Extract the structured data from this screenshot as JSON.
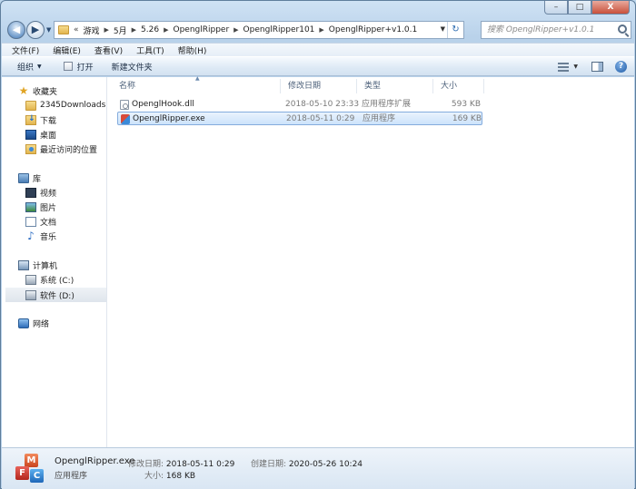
{
  "window": {
    "caption_minimize": "–",
    "caption_maximize": "□",
    "caption_close": "X"
  },
  "nav": {
    "back_glyph": "◀",
    "forward_glyph": "▶",
    "dropdown_glyph": "▼"
  },
  "address": {
    "lead": "«",
    "crumbs": [
      "游戏",
      "5月",
      "5.26",
      "OpenglRipper",
      "OpenglRipper101",
      "OpenglRipper+v1.0.1"
    ],
    "separator": "▶",
    "dropdown_glyph": "▼",
    "refresh_glyph": "↻"
  },
  "search": {
    "placeholder": "搜索 OpenglRipper+v1.0.1"
  },
  "menubar": {
    "items": [
      "文件(F)",
      "编辑(E)",
      "查看(V)",
      "工具(T)",
      "帮助(H)"
    ]
  },
  "toolbar": {
    "organize": "组织",
    "organize_caret": "▼",
    "open": "打开",
    "new_folder": "新建文件夹",
    "view_caret": "▼",
    "help_glyph": "?"
  },
  "sidebar": {
    "favorites": "收藏夹",
    "favorites_items": [
      "2345Downloads",
      "下载",
      "桌面",
      "最近访问的位置"
    ],
    "libraries": "库",
    "libraries_items": [
      "视频",
      "图片",
      "文档",
      "音乐"
    ],
    "computer": "计算机",
    "computer_items": [
      "系统 (C:)",
      "软件 (D:)"
    ],
    "network": "网络"
  },
  "columns": {
    "name": "名称",
    "date": "修改日期",
    "type": "类型",
    "size": "大小",
    "sort_glyph": "▲"
  },
  "files": [
    {
      "name": "OpenglHook.dll",
      "date": "2018-05-10 23:33",
      "type": "应用程序扩展",
      "size": "593 KB"
    },
    {
      "name": "OpenglRipper.exe",
      "date": "2018-05-11 0:29",
      "type": "应用程序",
      "size": "169 KB"
    }
  ],
  "details": {
    "icon_letters": [
      "M",
      "F",
      "C"
    ],
    "name": "OpenglRipper.exe",
    "type": "应用程序",
    "modified_label": "修改日期:",
    "modified_value": "2018-05-11 0:29",
    "created_label": "创建日期:",
    "created_value": "2020-05-26 10:24",
    "size_label": "大小:",
    "size_value": "168 KB"
  }
}
